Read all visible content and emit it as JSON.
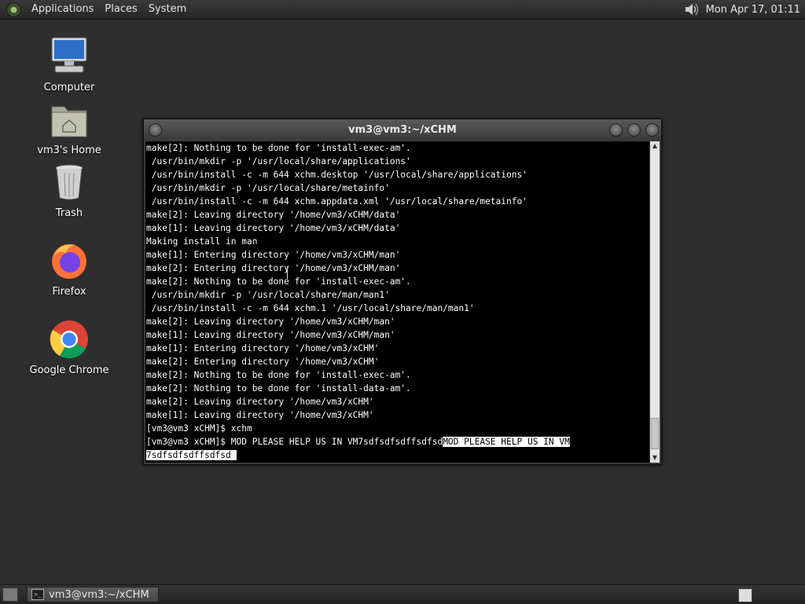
{
  "top_panel": {
    "menus": [
      "Applications",
      "Places",
      "System"
    ],
    "clock": "Mon Apr 17, 01:11"
  },
  "desktop_icons": [
    {
      "label": "Computer",
      "icon": "computer-icon"
    },
    {
      "label": "vm3's Home",
      "icon": "home-folder-icon"
    },
    {
      "label": "Trash",
      "icon": "trash-icon"
    },
    {
      "label": "Firefox",
      "icon": "firefox-icon"
    },
    {
      "label": "Google Chrome",
      "icon": "chrome-icon"
    }
  ],
  "terminal": {
    "title": "vm3@vm3:~/xCHM",
    "lines": [
      "make[2]: Nothing to be done for 'install-exec-am'.",
      " /usr/bin/mkdir -p '/usr/local/share/applications'",
      " /usr/bin/install -c -m 644 xchm.desktop '/usr/local/share/applications'",
      " /usr/bin/mkdir -p '/usr/local/share/metainfo'",
      " /usr/bin/install -c -m 644 xchm.appdata.xml '/usr/local/share/metainfo'",
      "make[2]: Leaving directory '/home/vm3/xCHM/data'",
      "make[1]: Leaving directory '/home/vm3/xCHM/data'",
      "Making install in man",
      "make[1]: Entering directory '/home/vm3/xCHM/man'",
      "make[2]: Entering directory '/home/vm3/xCHM/man'",
      "make[2]: Nothing to be done for 'install-exec-am'.",
      " /usr/bin/mkdir -p '/usr/local/share/man/man1'",
      " /usr/bin/install -c -m 644 xchm.1 '/usr/local/share/man/man1'",
      "make[2]: Leaving directory '/home/vm3/xCHM/man'",
      "make[1]: Leaving directory '/home/vm3/xCHM/man'",
      "make[1]: Entering directory '/home/vm3/xCHM'",
      "make[2]: Entering directory '/home/vm3/xCHM'",
      "make[2]: Nothing to be done for 'install-exec-am'.",
      "make[2]: Nothing to be done for 'install-data-am'.",
      "make[2]: Leaving directory '/home/vm3/xCHM'",
      "make[1]: Leaving directory '/home/vm3/xCHM'",
      "[vm3@vm3 xCHM]$ xchm"
    ],
    "prompt_line": "[vm3@vm3 xCHM]$ MOD PLEASE HELP US IN VM7sdfsdfsdffsdfsd",
    "selected_text": "MOD PLEASE HELP US IN VM",
    "wrapped_selected": "7sdfsdfsdffsdfsd "
  },
  "taskbar": {
    "task_label": "vm3@vm3:~/xCHM",
    "task_icon": "terminal-icon"
  }
}
